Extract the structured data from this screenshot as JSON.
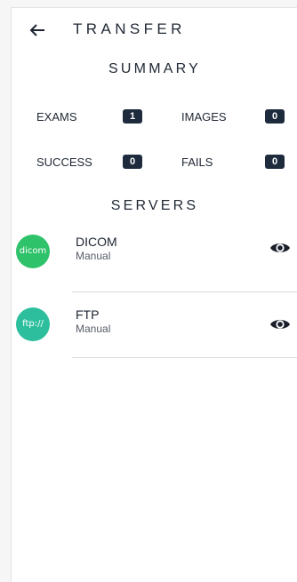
{
  "header": {
    "title": "TRANSFER",
    "back_icon": "arrow-left-icon"
  },
  "summary": {
    "title": "SUMMARY",
    "stats": [
      {
        "label": "EXAMS",
        "value": "1"
      },
      {
        "label": "IMAGES",
        "value": "0"
      },
      {
        "label": "SUCCESS",
        "value": "0"
      },
      {
        "label": "FAILS",
        "value": "0"
      }
    ]
  },
  "servers": {
    "title": "SERVERS",
    "items": [
      {
        "avatar": "dicom",
        "name": "DICOM",
        "mode": "Manual",
        "avatar_color": "#2ec26a",
        "action_icon": "eye-icon"
      },
      {
        "avatar": "ftp://",
        "name": "FTP",
        "mode": "Manual",
        "avatar_color": "#2dbf9d",
        "action_icon": "eye-icon"
      }
    ]
  },
  "colors": {
    "badge": "#1e2b3d",
    "text": "#222a36"
  }
}
